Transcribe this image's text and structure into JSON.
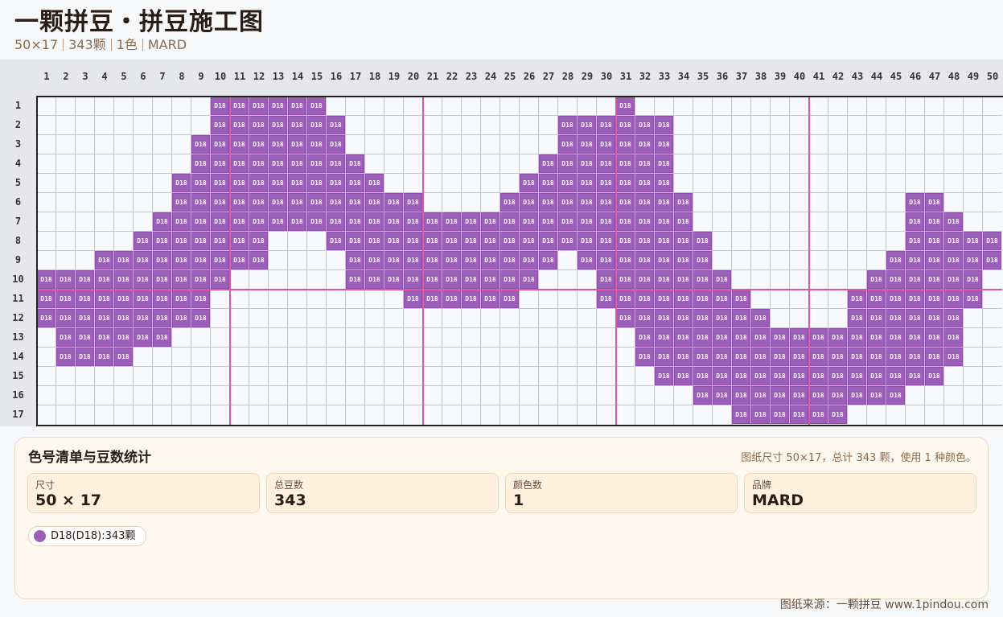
{
  "header": {
    "title": "一颗拼豆・拼豆施工图",
    "size": "50×17",
    "beads": "343颗",
    "colors": "1色",
    "brand": "MARD"
  },
  "board": {
    "columns": 50,
    "rows": 17,
    "bead_code": "D18",
    "bead_color": "#9b5fb8",
    "major_line_color": "#e0559c",
    "pattern": [
      "000000000111111000000000000000100000000000000000000",
      "000000000111111100000000000111111000000000000000000",
      "000000001111111100000000000111111000000000000000000",
      "000000001111111110000000001111111000000000000000000",
      "000000011111111111000000011111111000000000000000000",
      "000000011111111111110000111111111100000000000110000",
      "000000111111111111111111111111111100000000000111000",
      "000001111111000111111111111111111110000000000111110",
      "000111111111000011111111111011111110000000001111110",
      "111111111100000011111111110001111111000000011111100",
      "111111111000000000011111100001111111100000111111100",
      "111111111000000000000000000000111111110000111111000",
      "011111100000000000000000000000011111111111111111000",
      "011110000000000000000000000000011111111111111111000",
      "000000000000000000000000000000001111111111111110000",
      "000000000000000000000000000000000011111111111000000",
      "000000000000000000000000000000000000111111000000000"
    ]
  },
  "panel": {
    "title": "色号清单与豆数统计",
    "note": "图纸尺寸 50×17，总计 343 颗，使用 1 种颜色。",
    "cards": [
      {
        "label": "尺寸",
        "value": "50 × 17"
      },
      {
        "label": "总豆数",
        "value": "343"
      },
      {
        "label": "颜色数",
        "value": "1"
      },
      {
        "label": "品牌",
        "value": "MARD"
      }
    ],
    "legend": [
      {
        "text": "D18(D18):343颗",
        "color": "#9b5fb8"
      }
    ]
  },
  "footer": "图纸来源：一颗拼豆 www.1pindou.com"
}
